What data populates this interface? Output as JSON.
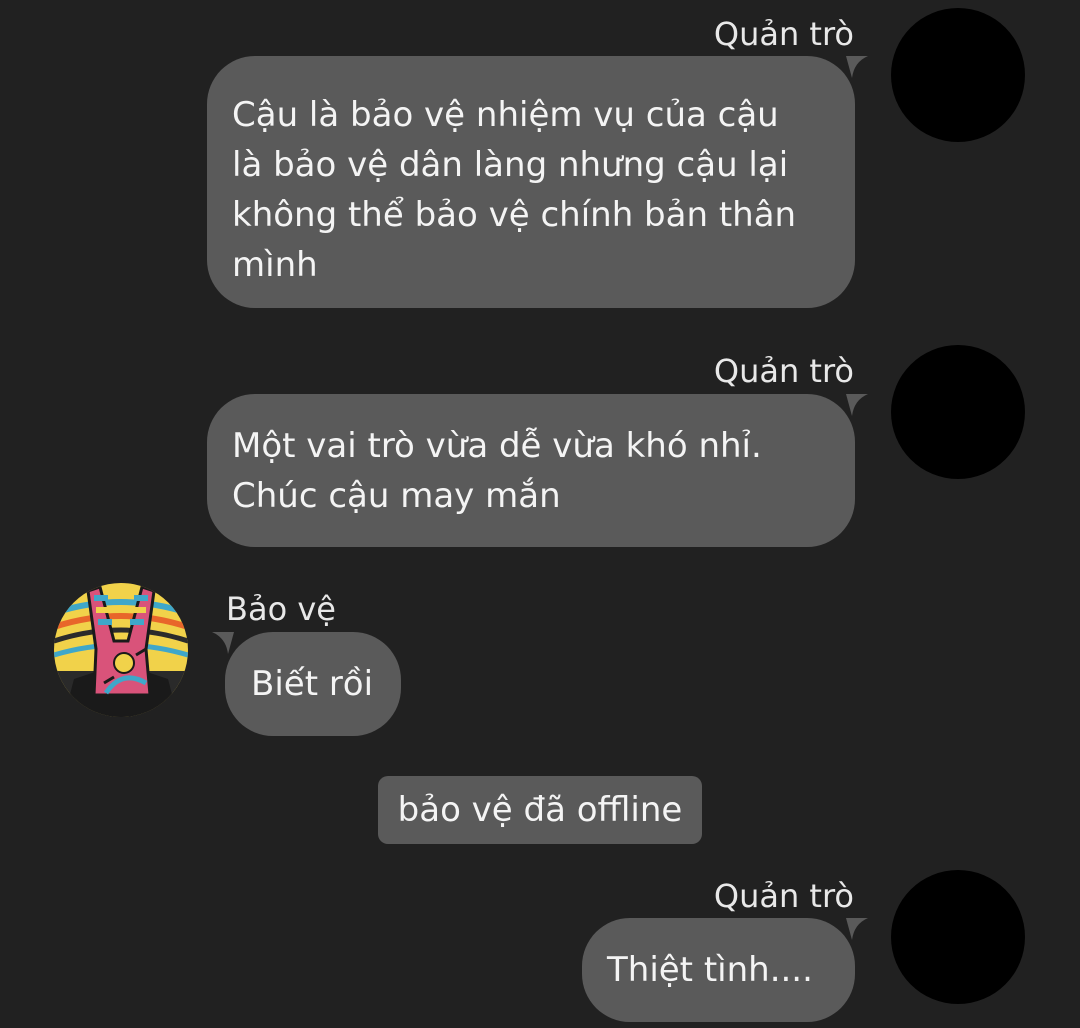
{
  "messages": [
    {
      "sender": "Quản trò",
      "lines": [
        "Cậu là bảo vệ nhiệm vụ của cậu",
        "là bảo vệ dân làng nhưng cậu lại",
        "không thể bảo vệ chính bản thân",
        "mình"
      ]
    },
    {
      "sender": "Quản trò",
      "lines": [
        "Một vai trò vừa dễ vừa khó nhỉ.",
        "Chúc cậu may mắn"
      ]
    },
    {
      "sender": "Bảo vệ",
      "lines": [
        "Biết rồi"
      ]
    },
    {
      "sender": "Quản trò",
      "lines": [
        "Thiệt tình...."
      ]
    }
  ],
  "system": {
    "notice": "bảo vệ đã offline"
  },
  "avatars": {
    "host": "black-circle-avatar",
    "guard": "peace-hand-illustration-avatar"
  },
  "colors": {
    "background": "#212121",
    "bubble": "#5a5a5a",
    "text": "#f4f4f4",
    "avatar_host": "#000000"
  }
}
